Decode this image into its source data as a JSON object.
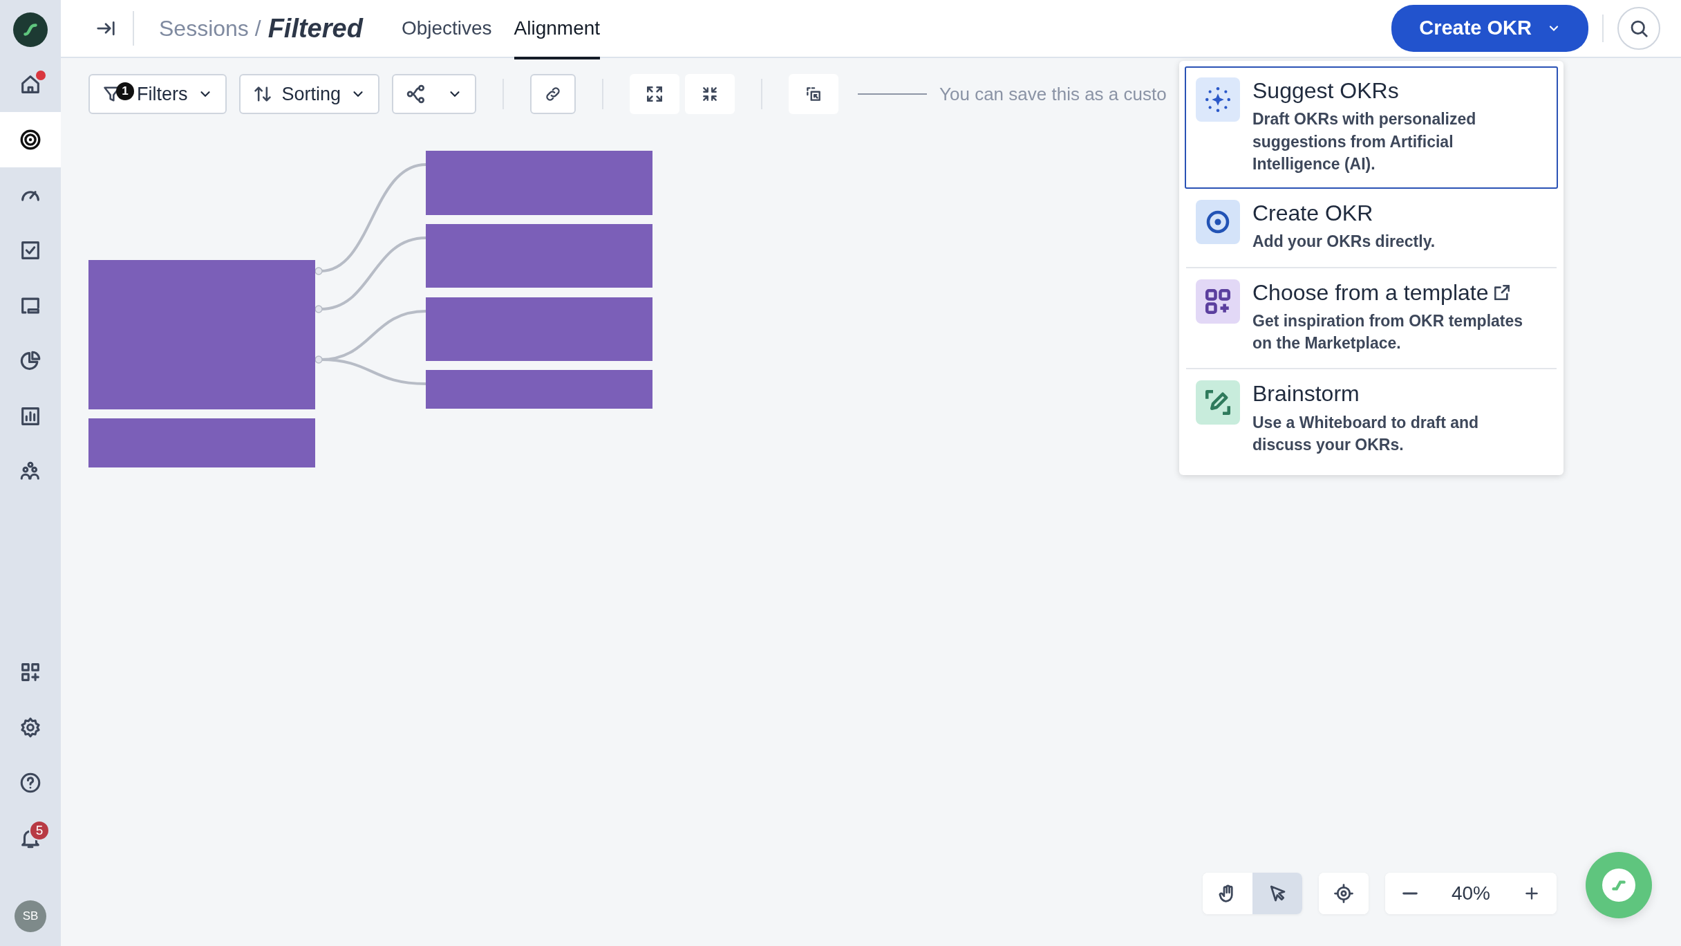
{
  "sidebar": {
    "items": [
      {
        "kind": "home",
        "selected": false,
        "dot": true
      },
      {
        "kind": "target",
        "selected": true,
        "dot": false
      },
      {
        "kind": "gauge",
        "selected": false,
        "dot": false
      },
      {
        "kind": "check",
        "selected": false,
        "dot": false
      },
      {
        "kind": "screen",
        "selected": false,
        "dot": false
      },
      {
        "kind": "pie",
        "selected": false,
        "dot": false
      },
      {
        "kind": "bars",
        "selected": false,
        "dot": false
      },
      {
        "kind": "people",
        "selected": false,
        "dot": false
      }
    ],
    "bottom_items": [
      {
        "kind": "apps"
      },
      {
        "kind": "gear"
      },
      {
        "kind": "help"
      },
      {
        "kind": "bell",
        "badge": "5"
      }
    ],
    "avatar": "SB"
  },
  "header": {
    "breadcrumb": "Sessions /",
    "title": "Filtered",
    "tabs": [
      {
        "label": "Objectives",
        "selected": false
      },
      {
        "label": "Alignment",
        "selected": true
      }
    ],
    "create_button": "Create OKR"
  },
  "toolbar": {
    "filters": {
      "label": "Filters",
      "count": "1"
    },
    "sorting": {
      "label": "Sorting"
    },
    "hint": "You can save this as a custo"
  },
  "menu": [
    {
      "kind": "ai",
      "title": "Suggest OKRs",
      "description": "Draft OKRs with personalized suggestions from Artificial Intelligence (AI).",
      "selected": true,
      "external": false
    },
    {
      "kind": "create",
      "title": "Create OKR",
      "description": "Add your OKRs directly.",
      "selected": false,
      "external": false
    },
    {
      "kind": "template",
      "title": "Choose from a template",
      "description": "Get inspiration from OKR templates on the Marketplace.",
      "selected": false,
      "external": true
    },
    {
      "kind": "brainstorm",
      "title": "Brainstorm",
      "description": "Use a Whiteboard to draft and discuss your OKRs.",
      "selected": false,
      "external": false
    }
  ],
  "canvas": {
    "nodes": [
      {
        "kind": "objective",
        "children": [
          {
            "kind": "objective"
          },
          {
            "kind": "objective"
          },
          {
            "kind": "objective"
          },
          {
            "kind": "objective"
          }
        ]
      },
      {
        "kind": "objective"
      }
    ]
  },
  "view_controls": {
    "tools": [
      {
        "kind": "hand",
        "selected": false
      },
      {
        "kind": "pointer",
        "selected": true
      }
    ],
    "zoom": "40%"
  }
}
